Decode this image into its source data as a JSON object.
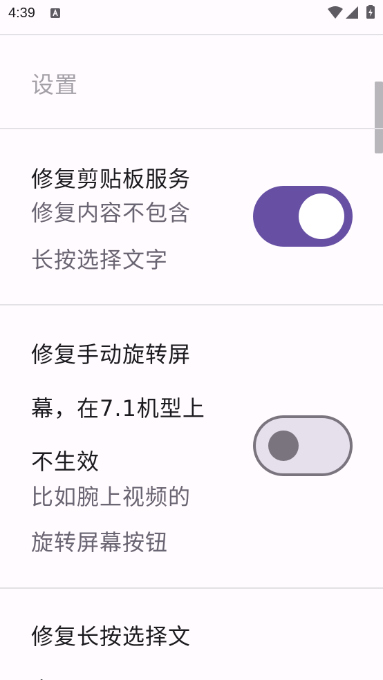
{
  "status_bar": {
    "time": "4:39",
    "notification_icon": "a-icon",
    "wifi_icon": "wifi-icon",
    "signal_icon": "signal-icon",
    "battery_icon": "battery-charging-icon"
  },
  "header": {
    "title": "设置"
  },
  "settings": [
    {
      "title": "修复剪贴板服务",
      "subtitle_line1": "修复内容不包含",
      "subtitle_line2": "长按选择文字",
      "enabled": true
    },
    {
      "title_line1": "修复手动旋转屏",
      "title_line2": "幕，在7.1机型上",
      "title_line3": "不生效",
      "subtitle_line1": "比如腕上视频的",
      "subtitle_line2": "旋转屏幕按钮",
      "enabled": false
    },
    {
      "title_line1": "修复长按选择文",
      "title_line2": "字"
    }
  ],
  "colors": {
    "accent": "#6750a4",
    "background": "#fffbfe",
    "toggle_off_track": "#e6e0ec",
    "toggle_off_outline": "#79747e",
    "title_text": "#a4a0a8",
    "subtitle_text": "#6a6572"
  }
}
